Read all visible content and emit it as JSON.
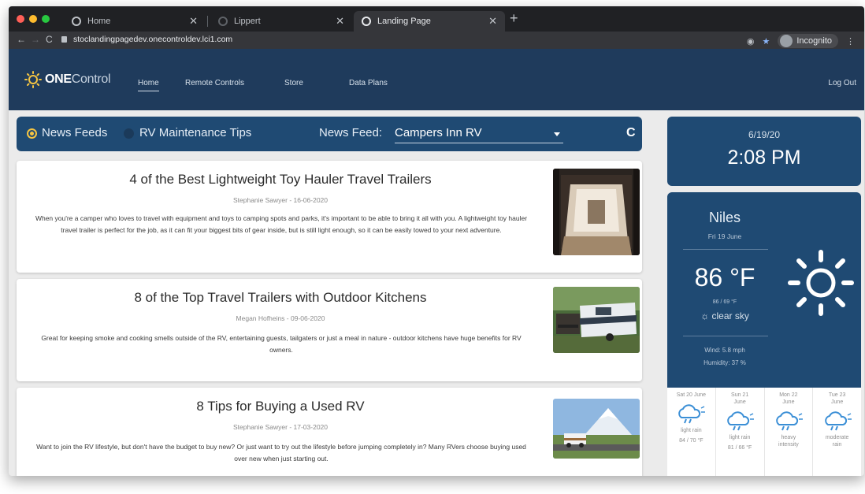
{
  "browser": {
    "tabs": [
      {
        "title": "Home",
        "active": false
      },
      {
        "title": "Lippert",
        "active": false
      },
      {
        "title": "Landing Page",
        "active": true
      }
    ],
    "url": "stoclandingpagedev.onecontroldev.lci1.com",
    "profile_label": "Incognito"
  },
  "header": {
    "logo_bold": "ONE",
    "logo_light": "Control",
    "nav": [
      "Home",
      "Remote Controls",
      "Store",
      "Data Plans"
    ],
    "logout": "Log Out"
  },
  "feedbar": {
    "option_news": "News Feeds",
    "option_tips": "RV Maintenance Tips",
    "feed_label": "News Feed:",
    "feed_value": "Campers Inn RV"
  },
  "articles": [
    {
      "title": "4 of the Best Lightweight Toy Hauler Travel Trailers",
      "meta": "Stephanie Sawyer - 16-06-2020",
      "body": "When you're a camper who loves to travel with equipment and toys to camping spots and parks, it's important to be able to bring it all with you. A lightweight toy hauler travel trailer is perfect for the job, as it can fit your biggest bits of gear inside, but is still light enough, so it can be easily towed to your next adventure."
    },
    {
      "title": "8 of the Top Travel Trailers with Outdoor Kitchens",
      "meta": "Megan Hofheins - 09-06-2020",
      "body": "Great for keeping smoke and cooking smells outside of the RV, entertaining guests, tailgaters or just a meal in nature - outdoor kitchens have huge benefits for RV owners."
    },
    {
      "title": "8 Tips for Buying a Used RV",
      "meta": "Stephanie Sawyer - 17-03-2020",
      "body": "Want to join the RV lifestyle, but don't have the budget to buy new? Or just want to try out the lifestyle before jumping completely in? Many RVers choose buying used over new when just starting out."
    }
  ],
  "clock": {
    "date": "6/19/20",
    "time": "2:08 PM"
  },
  "weather": {
    "city": "Niles",
    "date": "Fri 19 June",
    "temp": "86 °F",
    "range": "86 / 69 °F",
    "condition": "clear sky",
    "wind": "Wind: 5.8 mph",
    "humidity": "Humidity: 37 %",
    "forecast": [
      {
        "day": "Sat 20 June",
        "cond": "light rain",
        "temps": "84 / 70 °F"
      },
      {
        "day": "Sun 21 June",
        "cond": "light rain",
        "temps": "81 / 66 °F"
      },
      {
        "day": "Mon 22 June",
        "cond": "heavy intensity",
        "temps": ""
      },
      {
        "day": "Tue 23 June",
        "cond": "moderate rain",
        "temps": ""
      }
    ]
  },
  "colors": {
    "header_bg": "#1f3b5c",
    "panel_bg": "#1f4a73",
    "accent_yellow": "#f5c542"
  }
}
